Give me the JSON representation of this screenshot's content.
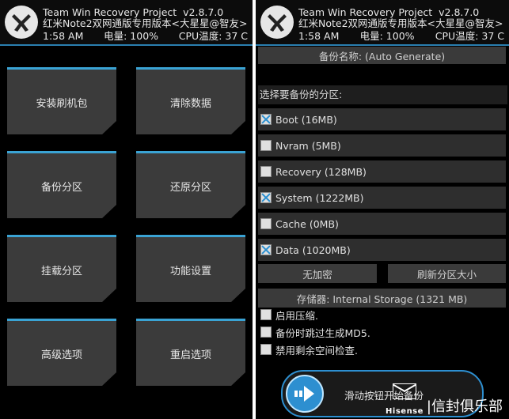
{
  "header": {
    "app_title": "Team Win Recovery Project",
    "version": "v2.8.7.0",
    "build_line": "红米Note2双网通版专用版本<大星星@智友>",
    "time": "1:58 AM",
    "battery": "电量: 100%",
    "cpu_temp": "CPU温度: 37 C"
  },
  "left_panel": {
    "tiles": [
      {
        "label": "安装刷机包"
      },
      {
        "label": "清除数据"
      },
      {
        "label": "备份分区"
      },
      {
        "label": "还原分区"
      },
      {
        "label": "挂载分区"
      },
      {
        "label": "功能设置"
      },
      {
        "label": "高级选项"
      },
      {
        "label": "重启选项"
      }
    ]
  },
  "right_panel": {
    "backup_name": "备份名称: (Auto Generate)",
    "partitions_label": "选择要备份的分区:",
    "partitions": [
      {
        "label": "Boot (16MB)",
        "checked": true
      },
      {
        "label": "Nvram (5MB)",
        "checked": false
      },
      {
        "label": "Recovery (128MB)",
        "checked": false
      },
      {
        "label": "System (1222MB)",
        "checked": true
      },
      {
        "label": "Cache (0MB)",
        "checked": false
      },
      {
        "label": "Data (1020MB)",
        "checked": true
      }
    ],
    "no_encrypt_label": "无加密",
    "refresh_sizes_label": "刷新分区大小",
    "storage_label": "存储器: Internal Storage (1321 MB)",
    "options": [
      {
        "label": "启用压缩.",
        "checked": false
      },
      {
        "label": "备份时跳过生成MD5.",
        "checked": false
      },
      {
        "label": "禁用剩余空间检查.",
        "checked": false
      }
    ],
    "slider_label": "滑动按钮开始备份"
  },
  "watermark": {
    "brand": "Hisense",
    "club": "|信封俱乐部"
  },
  "colors": {
    "accent": "#3aa3d4",
    "tile": "#3b3b3b",
    "background": "#000000"
  }
}
